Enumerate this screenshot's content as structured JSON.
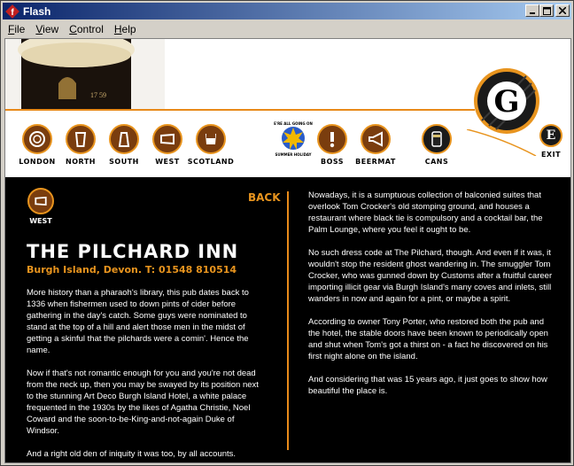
{
  "window": {
    "title": "Flash"
  },
  "menu": [
    {
      "label": "File",
      "ul": "F",
      "rest": "ile"
    },
    {
      "label": "View",
      "ul": "V",
      "rest": "iew"
    },
    {
      "label": "Control",
      "ul": "C",
      "rest": "ontrol"
    },
    {
      "label": "Help",
      "ul": "H",
      "rest": "elp"
    }
  ],
  "nav": {
    "london": "LONDON",
    "north": "NORTH",
    "south": "SOUTH",
    "west": "WEST",
    "scotland": "SCOTLAND",
    "boss": "BOSS",
    "beermat": "BEERMAT",
    "cans": "CANS",
    "exit": "EXIT"
  },
  "badge_text": "WE'RE ALL GOING ON A SUMMER HOLIDAY",
  "logo_letter": "G",
  "exit_letter": "E",
  "content": {
    "section_label": "WEST",
    "back_label": "BACK",
    "heading": "THE PILCHARD INN",
    "address": "Burgh Island, Devon. T: 01548 810514",
    "left_paragraphs": [
      "More history than a pharaoh's library, this pub dates back to 1336 when fishermen used to down pints of cider before gathering in the day's catch. Some guys were nominated to stand at the top of a hill and alert those men in the midst of getting a skinful that the pilchards were a comin'. Hence the name.",
      "Now if that's not romantic enough for you and you're not dead from the neck up, then you may be swayed by its position next to the stunning Art Deco Burgh Island Hotel, a white palace frequented in the 1930s by the likes of Agatha Christie, Noel Coward and the soon-to-be-King-and-not-again Duke of Windsor.",
      "And a right old den of iniquity it was too, by all accounts."
    ],
    "right_paragraphs": [
      "Nowadays, it is a sumptuous collection of balconied suites that overlook Tom Crocker's old stomping ground, and houses a restaurant where black tie is compulsory and a cocktail bar, the Palm Lounge, where you feel it ought to be.",
      "No such dress code at The Pilchard, though. And even if it was, it wouldn't stop the resident ghost wandering in. The smuggler Tom Crocker, who was gunned down by Customs after a fruitful career importing illicit gear via Burgh Island's many coves and inlets, still wanders in now and again for a pint, or maybe a spirit.",
      "According to owner Tony Porter, who restored both the pub and the hotel, the stable doors have been known to periodically open and shut when Tom's got a thirst on - a fact he discovered on his first night alone on the island.",
      "And considering that was 15 years ago, it just goes to show how beautiful the place is."
    ]
  },
  "colors": {
    "accent": "#e8941e",
    "brown": "#7a3d0e",
    "background": "#000000",
    "titlebar": "#0a246a"
  }
}
